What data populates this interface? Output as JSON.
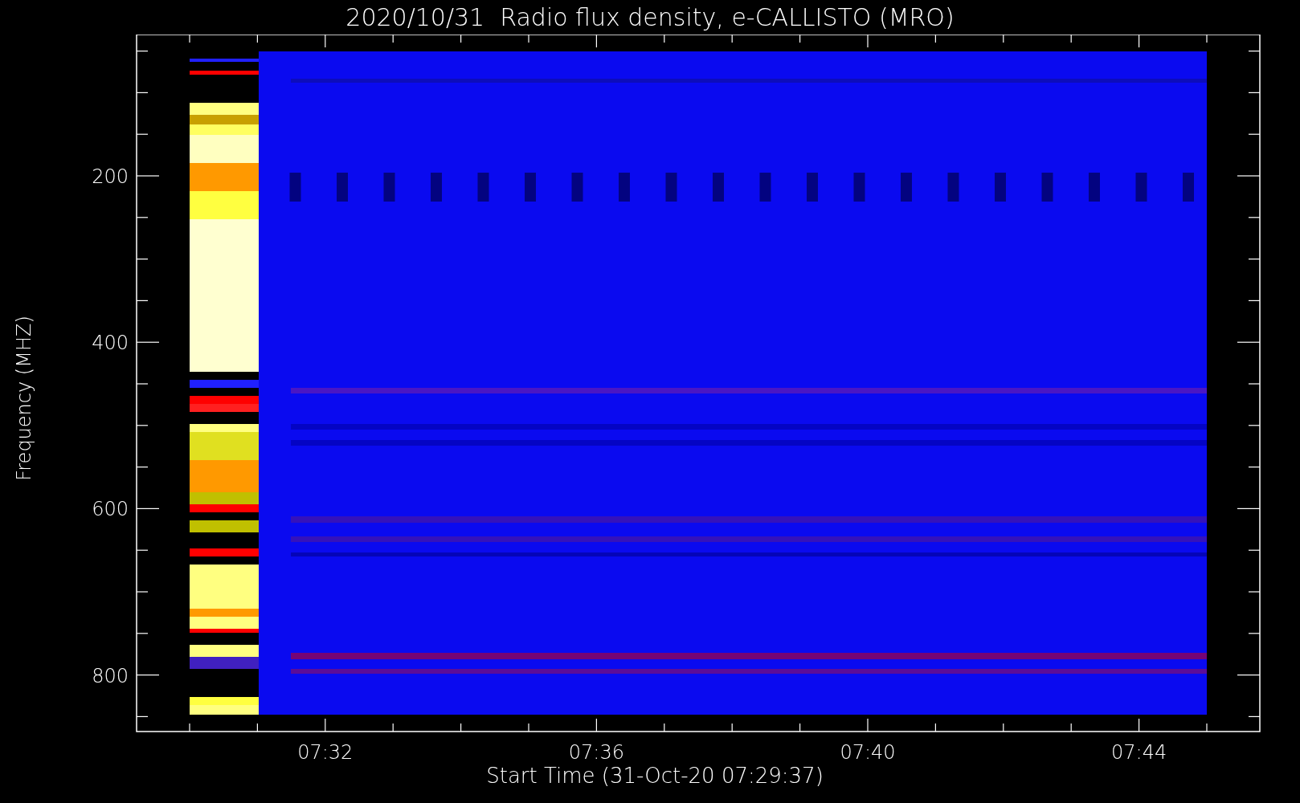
{
  "title": "2020/10/31  Radio flux density, e-CALLISTO (MRO)",
  "plot": {
    "ylabel": "Frequency (MHZ)",
    "xlabel": "Start Time (31-Oct-20 07:29:37)",
    "yticks": [
      "200",
      "400",
      "600",
      "800"
    ],
    "xticks": [
      "07:32",
      "07:36",
      "07:40",
      "07:44"
    ]
  }
}
